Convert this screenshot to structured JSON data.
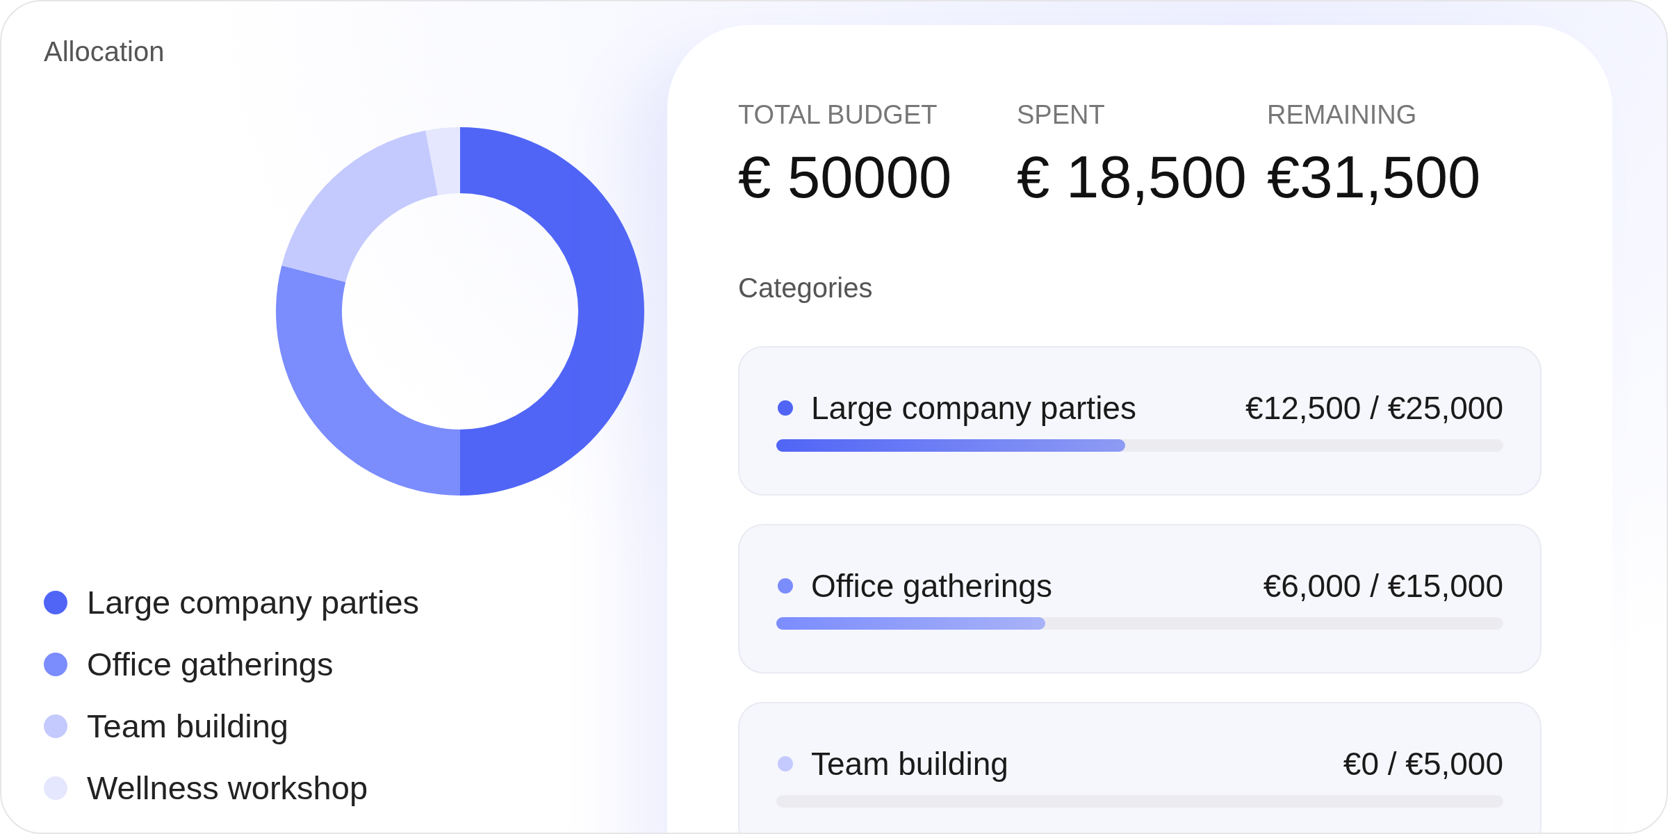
{
  "allocation": {
    "chart_data": {
      "type": "donut",
      "title": "Allocation",
      "categories": [
        "Large company parties",
        "Office gatherings",
        "Team building",
        "Wellness workshop"
      ],
      "values": [
        50,
        29,
        18,
        3
      ]
    },
    "legend": [
      {
        "color": "#5065f6"
      },
      {
        "color": "#7b8cfd"
      },
      {
        "color": "#c4cafe"
      },
      {
        "color": "#e4e7fd"
      }
    ]
  },
  "summary": [
    {
      "label": "TOTAL BUDGET",
      "value": "€ 50000"
    },
    {
      "label": "SPENT",
      "value": "€ 18,500"
    },
    {
      "label": "REMAINING",
      "value": "€31,500"
    }
  ],
  "categories": {
    "title": "Categories",
    "items": [
      {
        "name": "Large company parties",
        "amount": "€12,500 / €25,000",
        "color": "#5065f6",
        "level": 0.48
      },
      {
        "name": "Office gatherings",
        "amount": "€6,000 / €15,000",
        "color": "#7b8cfd",
        "level": 0.37
      },
      {
        "name": "Team building",
        "amount": "€0 / €5,000",
        "color": "#c4cafe",
        "level": 0
      }
    ]
  }
}
